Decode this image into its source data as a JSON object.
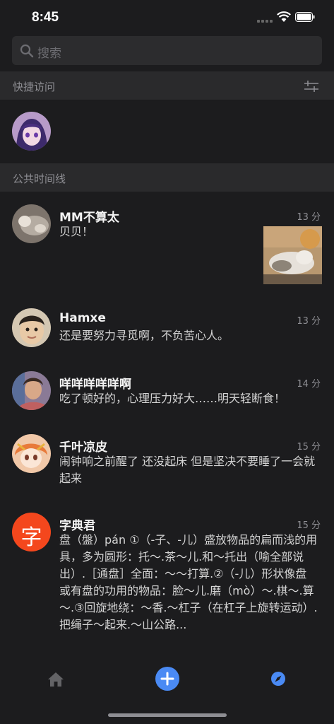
{
  "status": {
    "time": "8:45"
  },
  "search": {
    "placeholder": "搜索"
  },
  "quick_access": {
    "title": "快捷访问",
    "filter_icon": "sliders-icon"
  },
  "timeline": {
    "title": "公共时间线",
    "posts": [
      {
        "name": "MM不算太",
        "time": "13 分",
        "text": "贝贝！",
        "has_image": true
      },
      {
        "name": "Hamxe",
        "time": "13 分",
        "text": "还是要努力寻觅啊，不负苦心人。"
      },
      {
        "name": "咩咩咩咩咩啊",
        "time": "14 分",
        "text": "吃了顿好的，心理压力好大……明天轻断食！"
      },
      {
        "name": "千叶凉皮",
        "time": "15 分",
        "text": "闹钟响之前醒了 还没起床 但是坚决不要睡了一会就起来"
      },
      {
        "name": "字典君",
        "time": "15 分",
        "avatar_char": "字",
        "text": "盘（盤）pán ①（-子、-儿）盛放物品的扁而浅的用具，多为圆形：托～.茶～儿.和～托出（喻全部说出）.［通盘］全面：～～打算.②（-儿）形状像盘或有盘的功用的物品：脸～儿.磨（mò）～.棋～.算～.③回旋地绕：～香.～杠子（在杠子上旋转运动）.把绳子～起来.～山公路..."
      }
    ]
  },
  "tabs": {
    "home": "home-icon",
    "add": "add-icon",
    "explore": "compass-icon"
  },
  "colors": {
    "accent": "#4a8af4",
    "background": "#1c1c1e",
    "section": "#2a2a2c",
    "dict_avatar": "#f4471d"
  }
}
